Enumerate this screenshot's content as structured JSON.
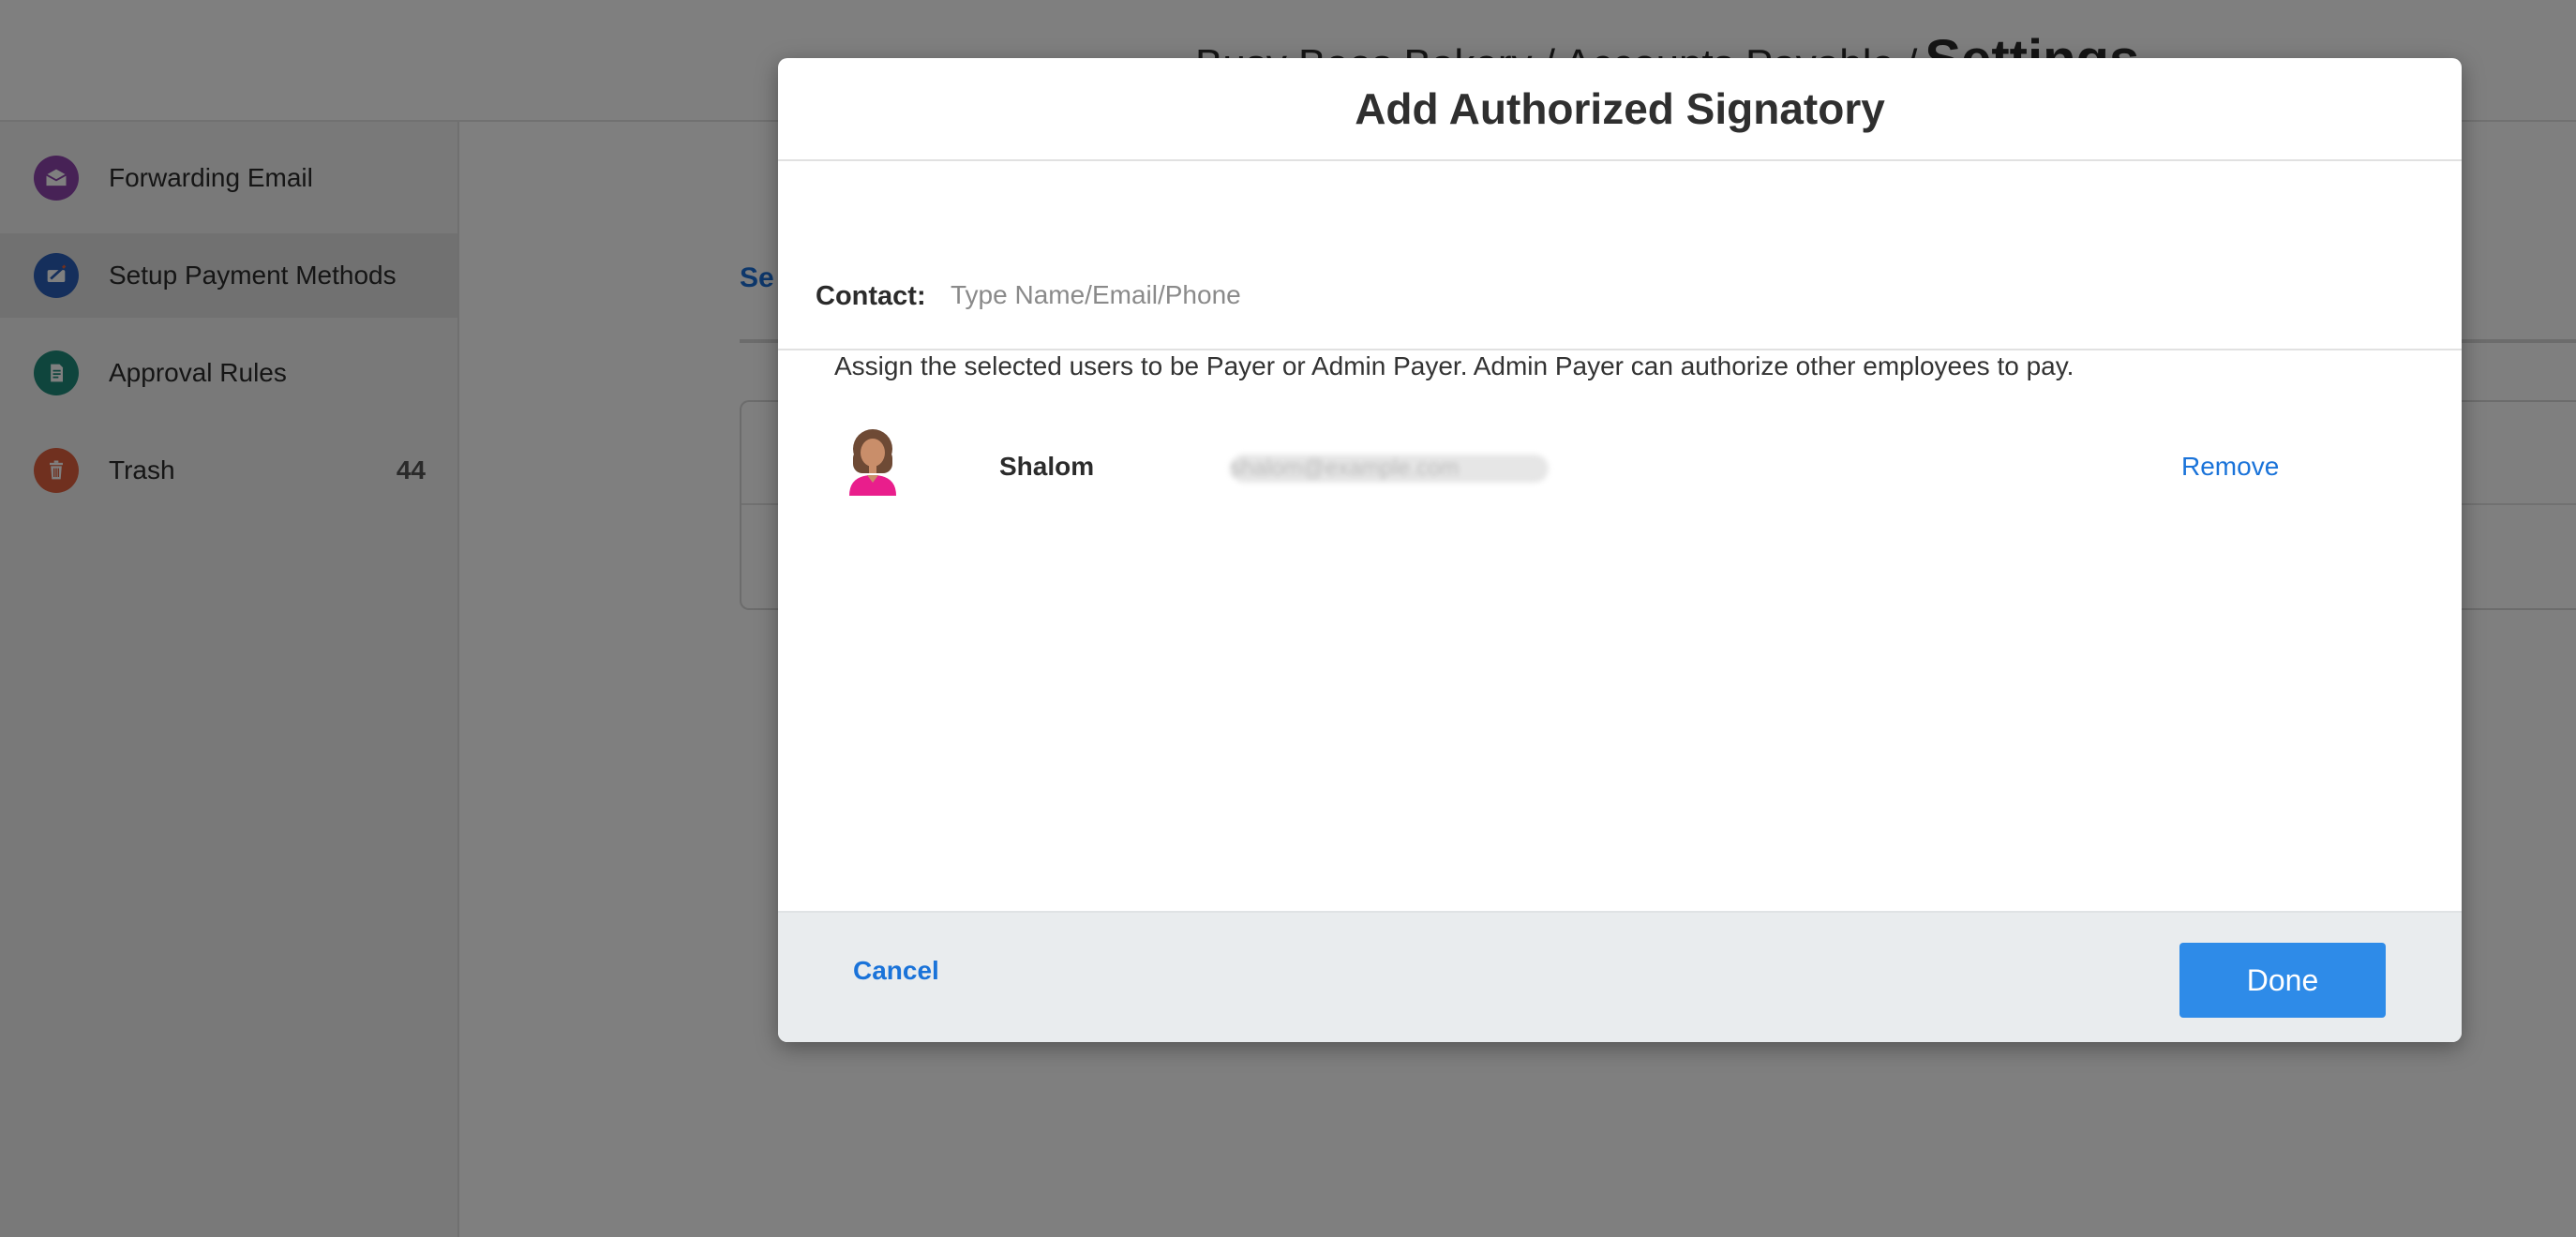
{
  "header": {
    "breadcrumb": "Busy Bees Bakery / Accounts Payable /",
    "current_page": "Settings"
  },
  "sidebar": {
    "items": [
      {
        "label": "Forwarding Email",
        "icon": "envelope-icon",
        "color": "#8e44ad"
      },
      {
        "label": "Setup Payment Methods",
        "icon": "check-pen-icon",
        "color": "#2b5fb8"
      },
      {
        "label": "Approval Rules",
        "icon": "document-icon",
        "color": "#1f8a7a"
      },
      {
        "label": "Trash",
        "icon": "trash-icon",
        "color": "#e0603f",
        "count": "44"
      }
    ]
  },
  "background": {
    "tab_label": "Se"
  },
  "modal": {
    "title": "Add Authorized Signatory",
    "contact_label": "Contact:",
    "contact_placeholder": "Type Name/Email/Phone",
    "contact_value": "",
    "assign_text": "Assign the selected users to be Payer or Admin Payer. Admin Payer can authorize other employees to pay.",
    "users": [
      {
        "name": "Shalom",
        "email": "shalom@example.com",
        "remove_label": "Remove"
      }
    ],
    "cancel_label": "Cancel",
    "done_label": "Done"
  },
  "colors": {
    "accent": "#2e8be8",
    "link": "#1a73d9",
    "footer_bg": "#e9ecee"
  }
}
